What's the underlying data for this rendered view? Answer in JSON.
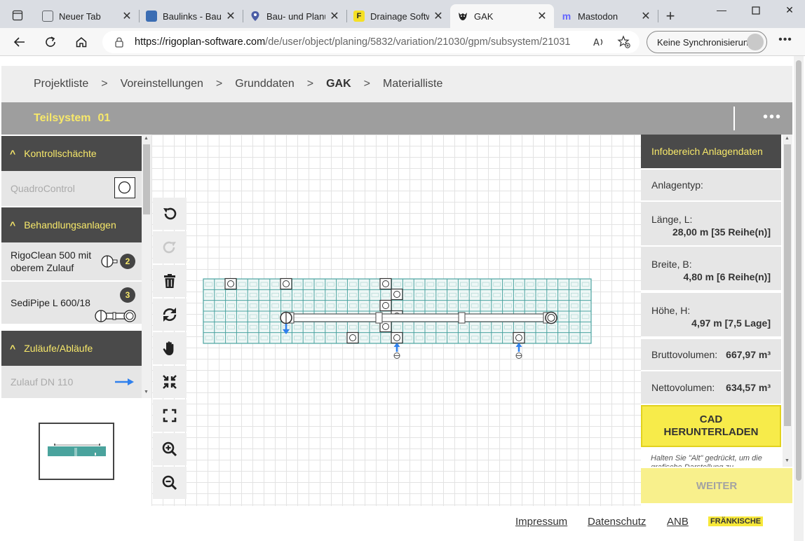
{
  "browser": {
    "tabs": [
      {
        "label": "Neuer Tab"
      },
      {
        "label": "Baulinks - Baupr"
      },
      {
        "label": "Bau- und Planun"
      },
      {
        "label": "Drainage Softwa"
      },
      {
        "label": "GAK"
      },
      {
        "label": "Mastodon"
      }
    ],
    "url_host": "https://rigoplan-software.com",
    "url_path": "/de/user/object/planing/5832/variation/21030/gpm/subsystem/21031",
    "sync_label": "Keine Synchronisierung"
  },
  "breadcrumb": {
    "items": [
      "Projektliste",
      "Voreinstellungen",
      "Grunddaten",
      "GAK",
      "Materialliste"
    ],
    "separator": ">"
  },
  "system": {
    "label": "Teilsystem",
    "number": "01"
  },
  "sidebar": {
    "sections": [
      {
        "label": "Kontrollschächte",
        "items": [
          {
            "label": "QuadroControl"
          }
        ]
      },
      {
        "label": "Behandlungsanlagen",
        "items": [
          {
            "label": "RigoClean 500 mit oberem Zulauf",
            "badge": "2"
          },
          {
            "label": "SediPipe L 600/18",
            "badge": "3"
          }
        ]
      },
      {
        "label": "Zuläufe/Abläufe",
        "items": [
          {
            "label": "Zulauf DN 110"
          }
        ]
      }
    ]
  },
  "info": {
    "title": "Infobereich Anlagendaten",
    "anlagentyp_label": "Anlagentyp:",
    "laenge_label": "Länge, L:",
    "laenge_value": "28,00 m [35 Reihe(n)]",
    "breite_label": "Breite, B:",
    "breite_value": "4,80 m [6 Reihe(n)]",
    "hoehe_label": "Höhe, H:",
    "hoehe_value": "4,97 m [7,5 Lage]",
    "brutto_label": "Bruttovolumen:",
    "brutto_value": "667,97 m³",
    "netto_label": "Nettovolumen:",
    "netto_value": "634,57 m³",
    "cad_line1": "CAD",
    "cad_line2": "HERUNTERLADEN",
    "hint": "Halten Sie \"Alt\" gedrückt, um die grafische Darstellung zu",
    "weiter": "WEITER"
  },
  "footer": {
    "impressum": "Impressum",
    "datenschutz": "Datenschutz",
    "anb": "ANB",
    "brand": "FRÄNKISCHE"
  },
  "colors": {
    "accent_yellow": "#f7e86a",
    "dark_header": "#4a4a4a",
    "grid_teal": "#4aa3a0",
    "arrow_blue": "#2f80ed"
  }
}
